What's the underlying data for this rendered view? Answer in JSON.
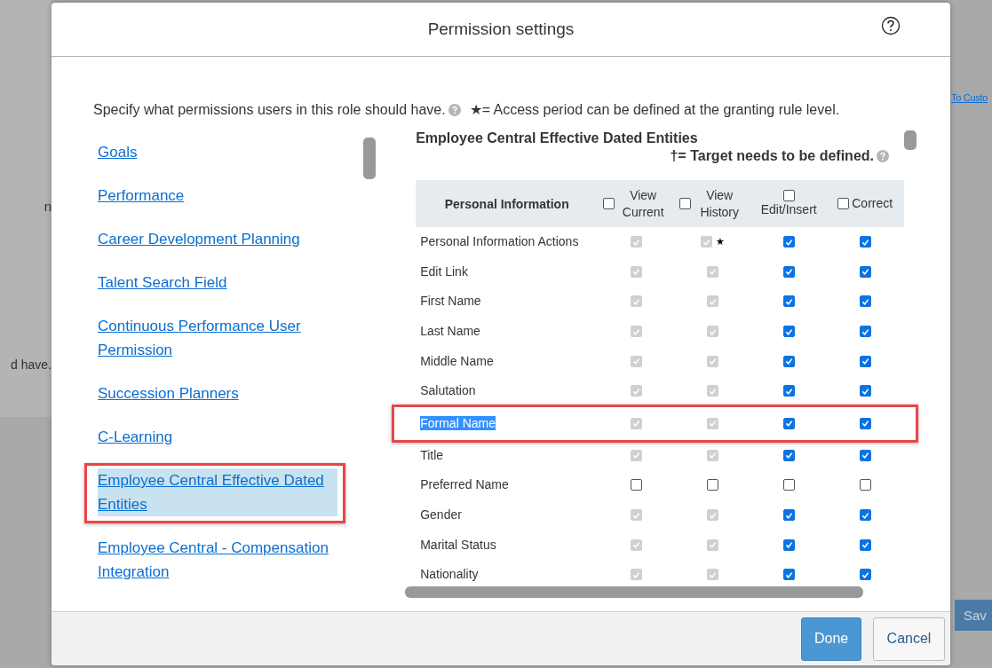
{
  "background": {
    "left_fragments": [
      "n",
      "d have."
    ],
    "link": "To Custo",
    "button": "Sav"
  },
  "dialog": {
    "title": "Permission settings",
    "intro": "Specify what permissions users in this role should have.",
    "legend_star": "★= Access period can be defined at the granting rule level."
  },
  "categories": [
    {
      "label": "Goals",
      "selected": false
    },
    {
      "label": "Performance",
      "selected": false
    },
    {
      "label": "Career Development Planning",
      "selected": false
    },
    {
      "label": "Talent Search Field",
      "selected": false
    },
    {
      "label": "Continuous Performance User Permission",
      "selected": false
    },
    {
      "label": "Succession Planners",
      "selected": false
    },
    {
      "label": "C-Learning",
      "selected": false
    },
    {
      "label": "Employee Central Effective Dated Entities",
      "selected": true
    },
    {
      "label": "Employee Central - Compensation Integration",
      "selected": false
    }
  ],
  "section": {
    "title": "Employee Central Effective Dated Entities",
    "legend_target": "†= Target needs to be defined."
  },
  "table": {
    "name_header": "Personal Information",
    "columns": [
      {
        "label": "View Current",
        "checked": false
      },
      {
        "label": "View History",
        "checked": false
      },
      {
        "label": "Edit/Insert",
        "checked": false
      },
      {
        "label": "Correct",
        "checked": false
      }
    ],
    "rows": [
      {
        "name": "Personal Information Actions",
        "highlighted": false,
        "cells": [
          {
            "checked": true,
            "disabled": true
          },
          {
            "checked": true,
            "disabled": true,
            "note": "★"
          },
          {
            "checked": true,
            "disabled": false
          },
          {
            "checked": true,
            "disabled": false
          }
        ]
      },
      {
        "name": "Edit Link",
        "highlighted": false,
        "cells": [
          {
            "checked": true,
            "disabled": true
          },
          {
            "checked": true,
            "disabled": true
          },
          {
            "checked": true,
            "disabled": false
          },
          {
            "checked": true,
            "disabled": false
          }
        ]
      },
      {
        "name": "First Name",
        "highlighted": false,
        "cells": [
          {
            "checked": true,
            "disabled": true
          },
          {
            "checked": true,
            "disabled": true
          },
          {
            "checked": true,
            "disabled": false
          },
          {
            "checked": true,
            "disabled": false
          }
        ]
      },
      {
        "name": "Last Name",
        "highlighted": false,
        "cells": [
          {
            "checked": true,
            "disabled": true
          },
          {
            "checked": true,
            "disabled": true
          },
          {
            "checked": true,
            "disabled": false
          },
          {
            "checked": true,
            "disabled": false
          }
        ]
      },
      {
        "name": "Middle Name",
        "highlighted": false,
        "cells": [
          {
            "checked": true,
            "disabled": true
          },
          {
            "checked": true,
            "disabled": true
          },
          {
            "checked": true,
            "disabled": false
          },
          {
            "checked": true,
            "disabled": false
          }
        ]
      },
      {
        "name": "Salutation",
        "highlighted": false,
        "cells": [
          {
            "checked": true,
            "disabled": true
          },
          {
            "checked": true,
            "disabled": true
          },
          {
            "checked": true,
            "disabled": false
          },
          {
            "checked": true,
            "disabled": false
          }
        ]
      },
      {
        "name": "Formal Name",
        "highlighted": true,
        "cells": [
          {
            "checked": true,
            "disabled": true
          },
          {
            "checked": true,
            "disabled": true
          },
          {
            "checked": true,
            "disabled": false
          },
          {
            "checked": true,
            "disabled": false
          }
        ]
      },
      {
        "name": "Title",
        "highlighted": false,
        "cells": [
          {
            "checked": true,
            "disabled": true
          },
          {
            "checked": true,
            "disabled": true
          },
          {
            "checked": true,
            "disabled": false
          },
          {
            "checked": true,
            "disabled": false
          }
        ]
      },
      {
        "name": "Preferred Name",
        "highlighted": false,
        "cells": [
          {
            "checked": false,
            "disabled": false
          },
          {
            "checked": false,
            "disabled": false
          },
          {
            "checked": false,
            "disabled": false
          },
          {
            "checked": false,
            "disabled": false
          }
        ]
      },
      {
        "name": "Gender",
        "highlighted": false,
        "cells": [
          {
            "checked": true,
            "disabled": true
          },
          {
            "checked": true,
            "disabled": true
          },
          {
            "checked": true,
            "disabled": false
          },
          {
            "checked": true,
            "disabled": false
          }
        ]
      },
      {
        "name": "Marital Status",
        "highlighted": false,
        "cells": [
          {
            "checked": true,
            "disabled": true
          },
          {
            "checked": true,
            "disabled": true
          },
          {
            "checked": true,
            "disabled": false
          },
          {
            "checked": true,
            "disabled": false
          }
        ]
      },
      {
        "name": "Nationality",
        "highlighted": false,
        "cells": [
          {
            "checked": true,
            "disabled": true
          },
          {
            "checked": true,
            "disabled": true
          },
          {
            "checked": true,
            "disabled": false
          },
          {
            "checked": true,
            "disabled": false
          }
        ]
      }
    ]
  },
  "footer": {
    "buttons": [
      {
        "label": "Done",
        "kind": "primary"
      },
      {
        "label": "Cancel",
        "kind": "secondary"
      }
    ]
  }
}
